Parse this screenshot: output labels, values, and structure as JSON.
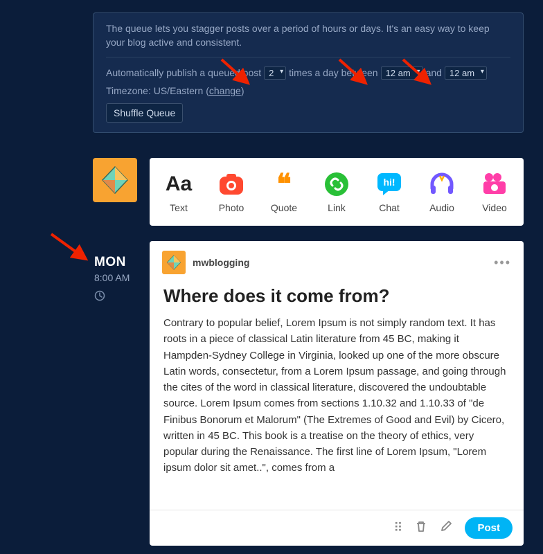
{
  "queue": {
    "description": "The queue lets you stagger posts over a period of hours or days. It's an easy way to keep your blog active and consistent.",
    "auto_prefix": "Automatically publish a queued post",
    "times_label": "times a day between",
    "and_label": "and",
    "freq_value": "2",
    "start_value": "12 am",
    "end_value": "12 am",
    "tz_prefix": "Timezone: US/Eastern (",
    "tz_link": "change",
    "tz_suffix": ")",
    "shuffle": "Shuffle Queue"
  },
  "compose": [
    {
      "label": "Text",
      "icon": "Aa",
      "color": "#222"
    },
    {
      "label": "Photo",
      "icon": "◉",
      "color": "#ff4930"
    },
    {
      "label": "Quote",
      "icon": "❝",
      "color": "#ff9100"
    },
    {
      "label": "Link",
      "icon": "🔗",
      "color": "#29c037"
    },
    {
      "label": "Chat",
      "icon": "hi!",
      "color": "#00b8ff"
    },
    {
      "label": "Audio",
      "icon": "🎧",
      "color": "#7258ff"
    },
    {
      "label": "Video",
      "icon": "🎬",
      "color": "#ff3ea8"
    }
  ],
  "schedule": {
    "day": "MON",
    "time": "8:00 AM"
  },
  "post": {
    "username": "mwblogging",
    "title": "Where does it come from?",
    "body": "Contrary to popular belief, Lorem Ipsum is not simply random text. It has roots in a piece of classical Latin literature from 45 BC, making it Hampden-Sydney College in Virginia, looked up one of the more obscure Latin words, consectetur, from a Lorem Ipsum passage, and going through the cites of the word in classical literature, discovered the undoubtable source. Lorem Ipsum comes from sections 1.10.32 and 1.10.33 of \"de Finibus Bonorum et Malorum\" (The Extremes of Good and Evil) by Cicero, written in 45 BC. This book is a treatise on the theory of ethics, very popular during the Renaissance. The first line of Lorem Ipsum, \"Lorem ipsum dolor sit amet..\", comes from a",
    "button": "Post"
  }
}
